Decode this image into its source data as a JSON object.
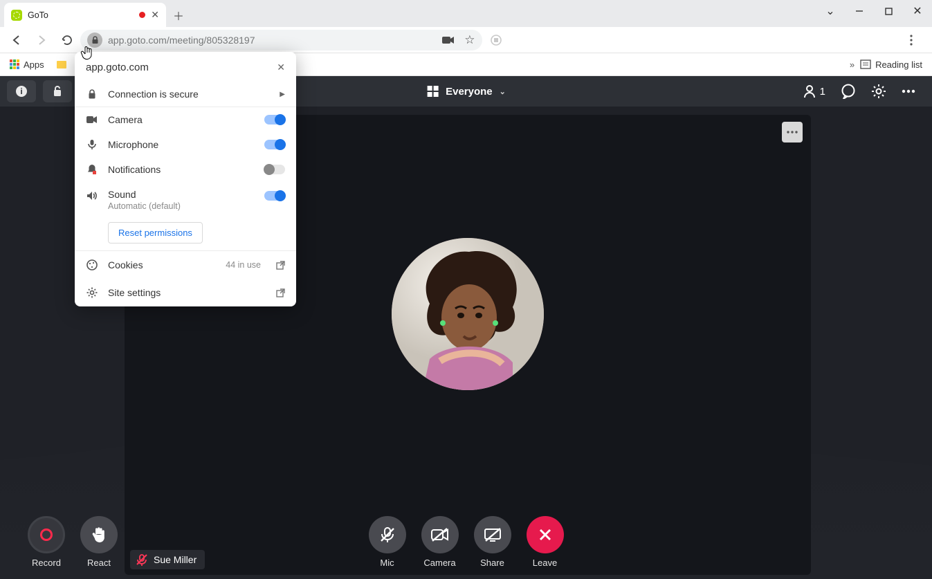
{
  "browser_tab": {
    "title": "GoTo"
  },
  "address_bar": {
    "url": "app.goto.com/meeting/805328197"
  },
  "bookmarks": {
    "apps": "Apps",
    "reading_list": "Reading list"
  },
  "site_info": {
    "host": "app.goto.com",
    "secure": "Connection is secure",
    "perm_camera": "Camera",
    "perm_microphone": "Microphone",
    "perm_notifications": "Notifications",
    "perm_sound": "Sound",
    "sound_sub": "Automatic (default)",
    "reset": "Reset permissions",
    "cookies": "Cookies",
    "cookies_count": "44 in use",
    "site_settings": "Site settings"
  },
  "meeting": {
    "layout_label": "Everyone",
    "participant_count": "1",
    "tile_name": "Sue Miller"
  },
  "controls": {
    "record": "Record",
    "react": "React",
    "mic": "Mic",
    "camera": "Camera",
    "share": "Share",
    "leave": "Leave"
  }
}
